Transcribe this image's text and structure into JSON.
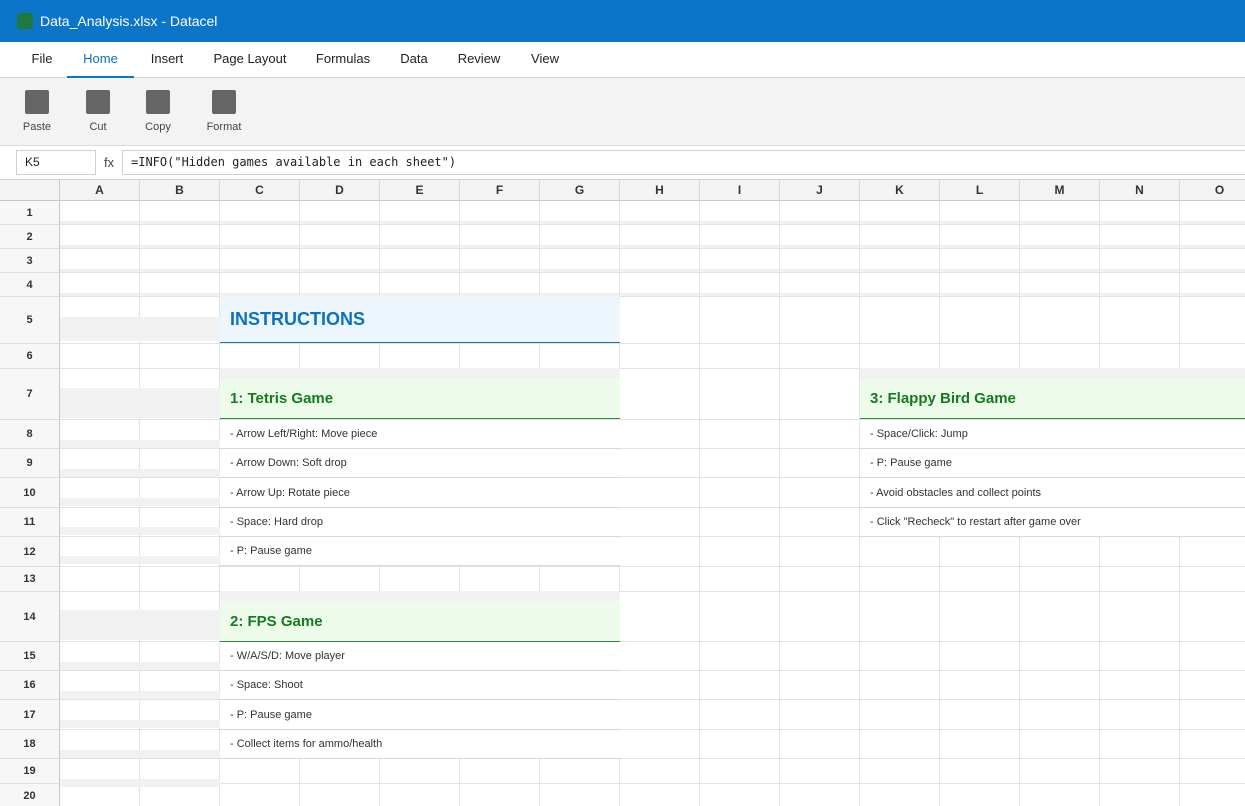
{
  "window": {
    "title": "Data_Analysis.xlsx - Datacel"
  },
  "menu": {
    "tabs": [
      {
        "label": "File"
      },
      {
        "label": "Home"
      },
      {
        "label": "Insert"
      },
      {
        "label": "Page Layout"
      },
      {
        "label": "Formulas"
      },
      {
        "label": "Data"
      },
      {
        "label": "Review"
      },
      {
        "label": "View"
      }
    ],
    "active": "Home"
  },
  "ribbon": {
    "buttons": [
      {
        "label": "Paste",
        "icon": "paste-icon"
      },
      {
        "label": "Cut",
        "icon": "cut-icon"
      },
      {
        "label": "Copy",
        "icon": "copy-icon"
      },
      {
        "label": "Format",
        "icon": "format-icon"
      }
    ]
  },
  "formula_bar": {
    "cell_ref": "K5",
    "fx_label": "fx",
    "formula": "=INFO(\"Hidden games available in each sheet\")"
  },
  "sheet": {
    "columns": [
      "A",
      "B",
      "C",
      "D",
      "E",
      "F",
      "G",
      "H",
      "I",
      "J",
      "K",
      "L",
      "M",
      "N",
      "O"
    ],
    "rows": [
      "1",
      "2",
      "3",
      "4",
      "5",
      "6",
      "7",
      "8",
      "9",
      "10",
      "11",
      "12",
      "13",
      "14",
      "15",
      "16",
      "17",
      "18",
      "19",
      "20"
    ]
  },
  "content": {
    "instructions_title": "INSTRUCTIONS",
    "tetris": {
      "title": "1: Tetris Game",
      "lines": [
        "- Arrow Left/Right: Move piece",
        "- Arrow Down: Soft drop",
        "- Arrow Up: Rotate piece",
        "- Space: Hard drop",
        "- P: Pause game"
      ]
    },
    "fps": {
      "title": "2: FPS Game",
      "lines": [
        "- W/A/S/D: Move player",
        "- Space: Shoot",
        "- P: Pause game",
        "- Collect items for ammo/health"
      ]
    },
    "flappy": {
      "title": "3: Flappy Bird Game",
      "lines": [
        "- Space/Click: Jump",
        "- P: Pause game",
        "- Avoid obstacles and collect points",
        "- Click \"Recheck\" to restart after game over"
      ]
    }
  },
  "colors": {
    "titlebar": "#0b75c9",
    "instructions_text": "#0b72c2",
    "game_title_text": "#187a20",
    "game_title_bg": "#edfbea"
  }
}
